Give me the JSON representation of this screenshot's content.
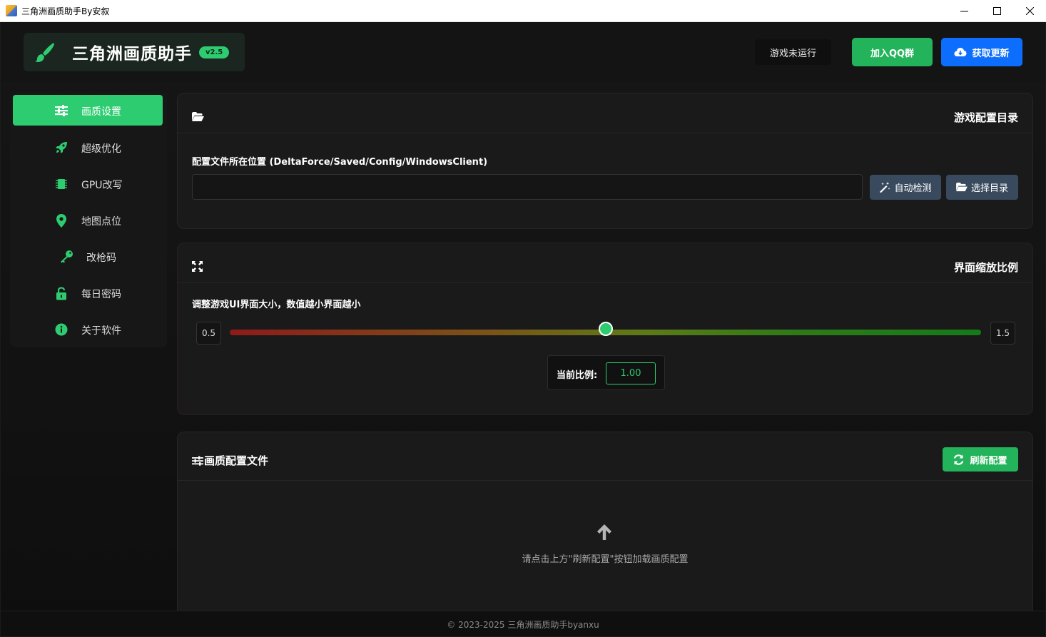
{
  "window": {
    "title": "三角洲画质助手By安叙",
    "minimize": "—",
    "maximize": "☐",
    "close": "✕"
  },
  "header": {
    "app_name": "三角洲画质助手",
    "version": "v2.5",
    "game_status": "游戏未运行",
    "join_qq_label": "加入QQ群",
    "update_label": "获取更新"
  },
  "sidebar": {
    "items": [
      {
        "label": "画质设置",
        "icon": "sliders-icon",
        "active": true
      },
      {
        "label": "超级优化",
        "icon": "rocket-icon",
        "active": false
      },
      {
        "label": "GPU改写",
        "icon": "chip-icon",
        "active": false
      },
      {
        "label": "地图点位",
        "icon": "map-pin-icon",
        "active": false
      },
      {
        "label": "改枪码",
        "icon": "key-icon",
        "active": false
      },
      {
        "label": "每日密码",
        "icon": "unlock-icon",
        "active": false
      },
      {
        "label": "关于软件",
        "icon": "info-icon",
        "active": false
      }
    ]
  },
  "config_dir": {
    "title": "游戏配置目录",
    "label": "配置文件所在位置 (DeltaForce/Saved/Config/WindowsClient)",
    "input_value": "",
    "input_placeholder": "",
    "auto_detect_label": "自动检测",
    "choose_dir_label": "选择目录"
  },
  "ui_scale": {
    "title": "界面缩放比例",
    "description": "调整游戏UI界面大小，数值越小界面越小",
    "min_label": "0.5",
    "max_label": "1.5",
    "min": 0.5,
    "max": 1.5,
    "value": 1.0,
    "current_label": "当前比例:",
    "current_value": "1.00"
  },
  "quality_files": {
    "title": "画质配置文件",
    "refresh_label": "刷新配置",
    "hint": "请点击上方\"刷新配置\"按钮加载画质配置"
  },
  "footer": {
    "text": "2023-2025 三角洲画质助手byanxu"
  },
  "colors": {
    "accent_green": "#2ecc71",
    "accent_blue": "#0d6efd",
    "dark_button": "#3a4a5e"
  }
}
